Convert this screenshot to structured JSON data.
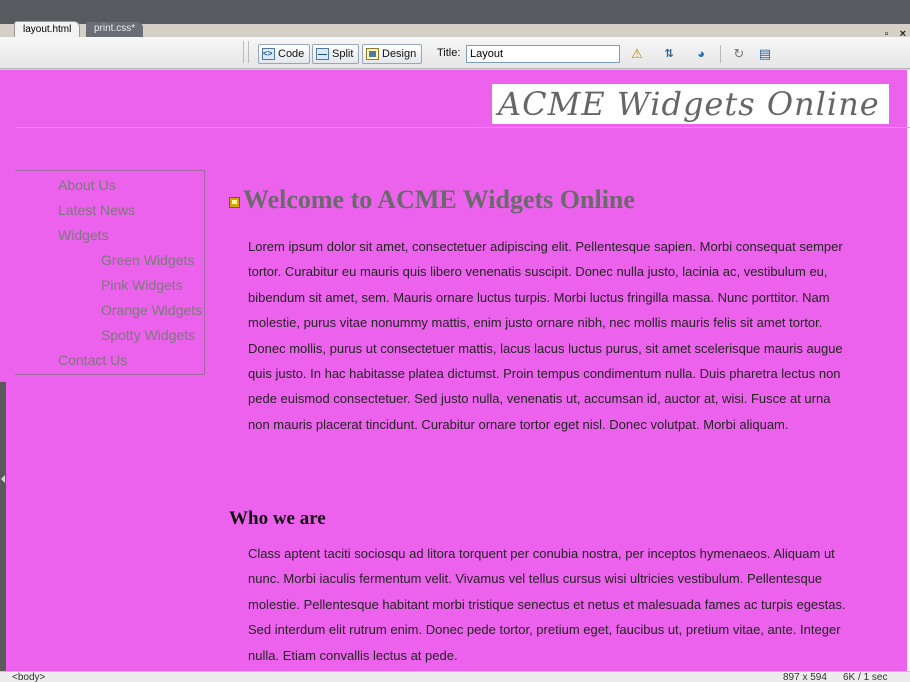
{
  "tabs": [
    {
      "label": "layout.html",
      "active": true
    },
    {
      "label": "print.css*",
      "active": false
    }
  ],
  "toolbar": {
    "code_label": "Code",
    "split_label": "Split",
    "design_label": "Design",
    "title_label": "Title:",
    "title_value": "Layout",
    "icons": [
      "check-browser-icon",
      "file-transfer-icon",
      "preview-globe-icon",
      "refresh-icon",
      "view-options-icon"
    ]
  },
  "window_controls": "_ ▫ ×",
  "page": {
    "banner": "ACME Widgets Online",
    "nav": [
      {
        "label": "About Us",
        "level": 0
      },
      {
        "label": "Latest News",
        "level": 0
      },
      {
        "label": "Widgets",
        "level": 0
      },
      {
        "label": "Green Widgets",
        "level": 1
      },
      {
        "label": "Pink Widgets",
        "level": 1
      },
      {
        "label": "Orange Widgets",
        "level": 1
      },
      {
        "label": "Spotty Widgets",
        "level": 1
      },
      {
        "label": "Contact Us",
        "level": 0
      }
    ],
    "heading": "Welcome to ACME Widgets Online",
    "paragraph1": "Lorem ipsum dolor sit amet, consectetuer adipiscing elit. Pellentesque sapien. Morbi consequat semper tortor. Curabitur eu mauris quis libero venenatis suscipit. Donec nulla justo, lacinia ac, vestibulum eu, bibendum sit amet, sem. Mauris ornare luctus turpis. Morbi luctus fringilla massa. Nunc porttitor. Nam molestie, purus vitae nonummy mattis, enim justo ornare nibh, nec mollis mauris felis sit amet tortor. Donec mollis, purus ut consectetuer mattis, lacus lacus luctus purus, sit amet scelerisque mauris augue quis justo. In hac habitasse platea dictumst. Proin tempus condimentum nulla. Duis pharetra lectus non pede euismod consectetuer. Sed justo nulla, venenatis ut, accumsan id, auctor at, wisi. Fusce at urna non mauris placerat tincidunt. Curabitur ornare tortor eget nisl. Donec volutpat. Morbi aliquam.",
    "subheading": "Who we are",
    "paragraph2": "Class aptent taciti sociosqu ad litora torquent per conubia nostra, per inceptos hymenaeos. Aliquam ut nunc. Morbi iaculis fermentum velit. Vivamus vel tellus cursus wisi ultricies vestibulum. Pellentesque molestie. Pellentesque habitant morbi tristique senectus et netus et malesuada fames ac turpis egestas. Sed interdum elit rutrum enim. Donec pede tortor, pretium eget, faucibus ut, pretium vitae, ante. Integer nulla. Etiam convallis lectus at pede."
  },
  "status": {
    "tag": "<body>",
    "dimensions": "897 x 594",
    "file_stats": "6K / 1 sec"
  },
  "colors": {
    "canvas_background": "#ec62ec",
    "banner_background": "#ffffff",
    "nav_text": "#7a7a7a",
    "heading_text": "#6a6a6a"
  }
}
